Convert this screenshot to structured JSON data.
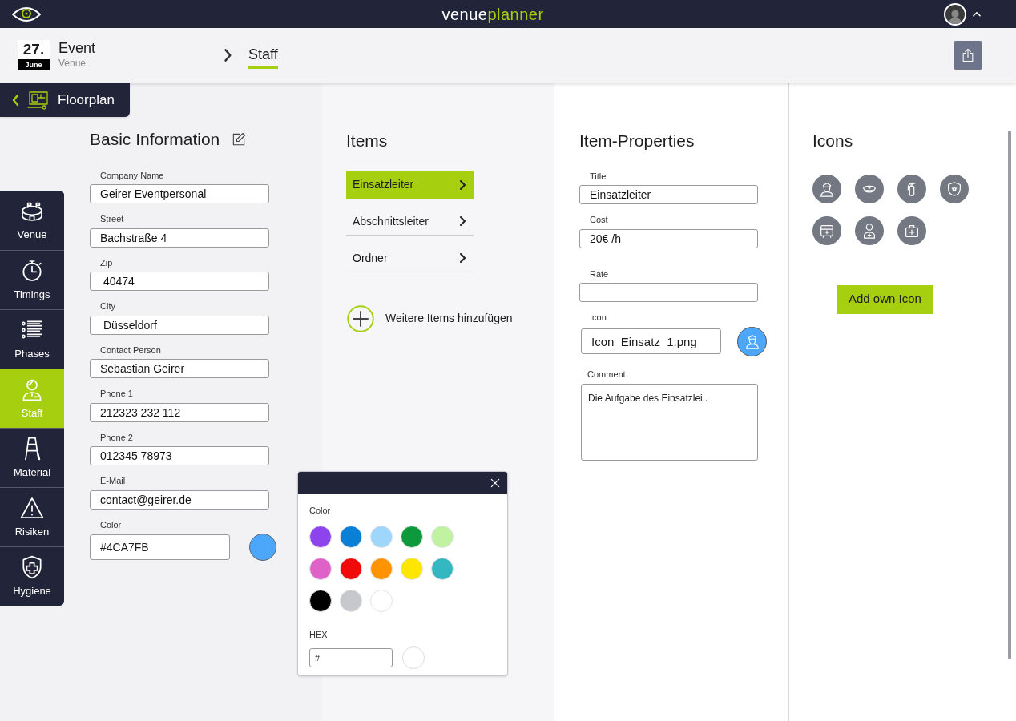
{
  "top_bar": {
    "brand_parts": [
      "venue",
      "planner"
    ]
  },
  "header": {
    "date_day": "27.",
    "date_month": "June",
    "event_title": "Event",
    "event_subtitle": "Venue",
    "breadcrumb": "Staff"
  },
  "floorplan_tab": {
    "label": "Floorplan"
  },
  "nav": [
    {
      "kind": "venue",
      "label": "Venue",
      "selected": false
    },
    {
      "kind": "timings",
      "label": "Timings",
      "selected": false
    },
    {
      "kind": "phases",
      "label": "Phases",
      "selected": false
    },
    {
      "kind": "staff",
      "label": "Staff",
      "selected": true
    },
    {
      "kind": "material",
      "label": "Material",
      "selected": false
    },
    {
      "kind": "risks",
      "label": "Risiken",
      "selected": false
    },
    {
      "kind": "hygiene",
      "label": "Hygiene",
      "selected": false
    }
  ],
  "basic_information": {
    "title": "Basic Information",
    "fields": [
      {
        "label": "Company Name",
        "value": "Geirer Eventpersonal"
      },
      {
        "label": "Street",
        "value": "Bachstraße 4"
      },
      {
        "label": "Zip",
        "value": " 40474"
      },
      {
        "label": "City",
        "value": " Düsseldorf"
      },
      {
        "label": "Contact Person",
        "value": "Sebastian Geirer"
      },
      {
        "label": "Phone 1",
        "value": "212323 232 112"
      },
      {
        "label": "Phone 2",
        "value": "012345 78973"
      },
      {
        "label": "E-Mail",
        "value": "contact@geirer.de"
      }
    ],
    "color": {
      "label": "Color",
      "value": "#4CA7FB",
      "color": "#4ca7fb"
    }
  },
  "items": {
    "title": "Items",
    "list": [
      {
        "label": "Einsatzleiter",
        "selected": true
      },
      {
        "label": "Abschnittsleiter",
        "selected": false
      },
      {
        "label": "Ordner",
        "selected": false
      }
    ],
    "add_label": "Weitere Items hinzufügen"
  },
  "item_properties": {
    "title": "Item-Properties",
    "title_label": "Title",
    "title_value": "Einsatzleiter",
    "cost_label": "Cost",
    "cost_value": "20€ /h",
    "rate_label": "Rate",
    "icon_label": "Icon",
    "icon_value": "Icon_Einsatz_1.png",
    "comment_label": "Comment",
    "comment_value": "Die Aufgabe des Einsatzlei.."
  },
  "icons": {
    "title": "Icons",
    "list": [
      {
        "kind": "officer"
      },
      {
        "kind": "cap"
      },
      {
        "kind": "extinguisher"
      },
      {
        "kind": "badge"
      },
      {
        "kind": "ambulance"
      },
      {
        "kind": "medic"
      },
      {
        "kind": "firstaid"
      }
    ],
    "add_button": "Add own Icon"
  },
  "color_popover": {
    "color_label": "Color",
    "swatches": [
      {
        "color": "#8e44ec"
      },
      {
        "color": "#0a7fd6"
      },
      {
        "color": "#9fd6fb"
      },
      {
        "color": "#0e9a3c"
      },
      {
        "color": "#c1f2a2"
      },
      {
        "color": "#de62c7"
      },
      {
        "color": "#f00a0a"
      },
      {
        "color": "#ff9300"
      },
      {
        "color": "#ffe600"
      },
      {
        "color": "#33b7c0"
      },
      {
        "color": "#000000"
      },
      {
        "color": "#c6c8cd"
      },
      {
        "color": "#ffffff"
      }
    ],
    "hex_label": "HEX",
    "hex_value": "#"
  }
}
